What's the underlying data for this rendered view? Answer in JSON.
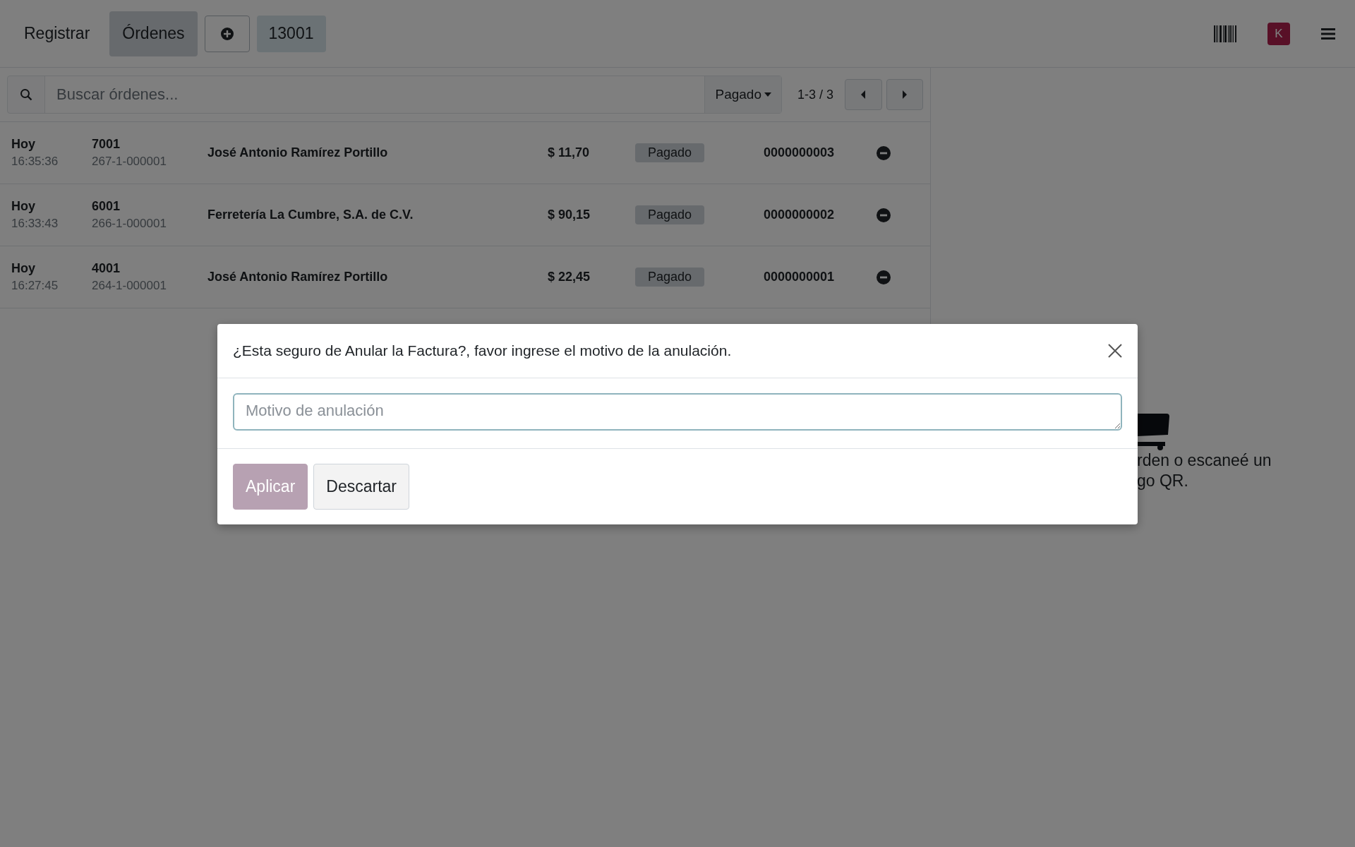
{
  "navbar": {
    "tabs": [
      {
        "label": "Registrar",
        "selected": false
      },
      {
        "label": "Órdenes",
        "selected": true
      }
    ],
    "order_number": "13001",
    "avatar": "K"
  },
  "search": {
    "placeholder": "Buscar órdenes...",
    "filter": "Pagado",
    "pager": "1-3 / 3"
  },
  "orders": [
    {
      "day": "Hoy",
      "time": "16:35:36",
      "number": "7001",
      "reference": "267-1-000001",
      "customer": "José Antonio Ramírez Portillo",
      "total": "$ 11,70",
      "status": "Pagado",
      "invoice": "0000000003"
    },
    {
      "day": "Hoy",
      "time": "16:33:43",
      "number": "6001",
      "reference": "266-1-000001",
      "customer": "Ferretería La Cumbre, S.A. de C.V.",
      "total": "$ 90,15",
      "status": "Pagado",
      "invoice": "0000000002"
    },
    {
      "day": "Hoy",
      "time": "16:27:45",
      "number": "4001",
      "reference": "264-1-000001",
      "customer": "José Antonio Ramírez Portillo",
      "total": "$ 22,45",
      "status": "Pagado",
      "invoice": "0000000001"
    }
  ],
  "empty_state": {
    "lines": [
      "rden o escaneé un",
      "go QR."
    ]
  },
  "dialog": {
    "title": "¿Esta seguro de Anular la Factura?, favor ingrese el motivo de la anulación.",
    "placeholder": "Motivo de anulación",
    "buttons": [
      {
        "label": "Aplicar",
        "kind": "primary",
        "disabled": true
      },
      {
        "label": "Descartar",
        "kind": "secondary",
        "disabled": false
      }
    ]
  }
}
